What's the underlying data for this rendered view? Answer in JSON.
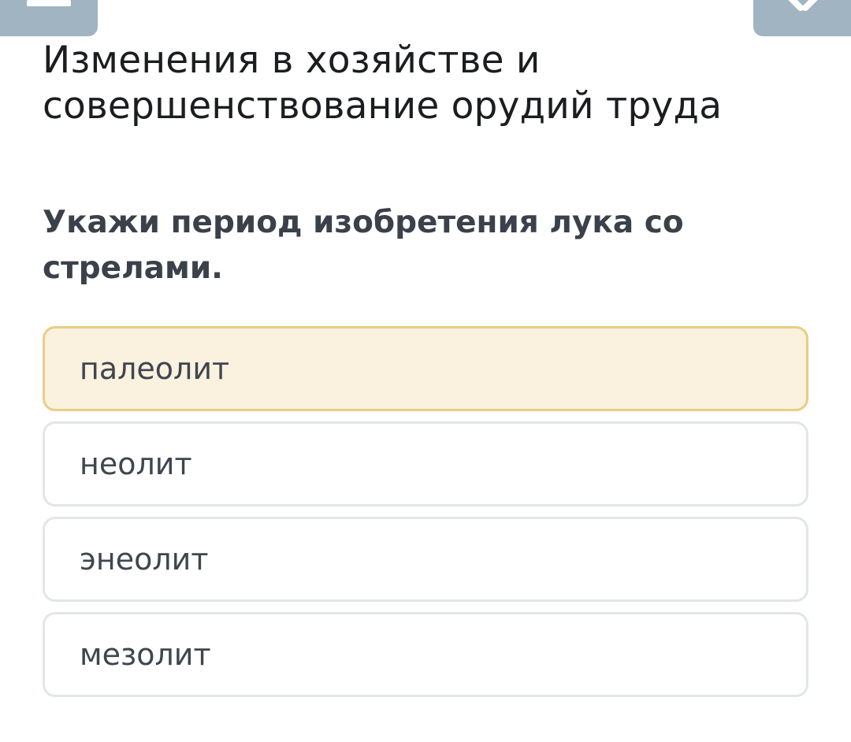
{
  "header": {
    "menu_icon": "menu-icon",
    "close_icon": "close-icon"
  },
  "section_title": "Изменения в хозяйстве и совершенствование орудий труда",
  "question": "Укажи период изобретения лука со стрелами.",
  "options": [
    {
      "label": "палеолит",
      "selected": true
    },
    {
      "label": "неолит",
      "selected": false
    },
    {
      "label": "энеолит",
      "selected": false
    },
    {
      "label": "мезолит",
      "selected": false
    }
  ],
  "colors": {
    "header_button": "#a0b4c2",
    "selected_bg": "#faf1df",
    "selected_border": "#e9cd84",
    "option_border": "#e1e6e9"
  }
}
